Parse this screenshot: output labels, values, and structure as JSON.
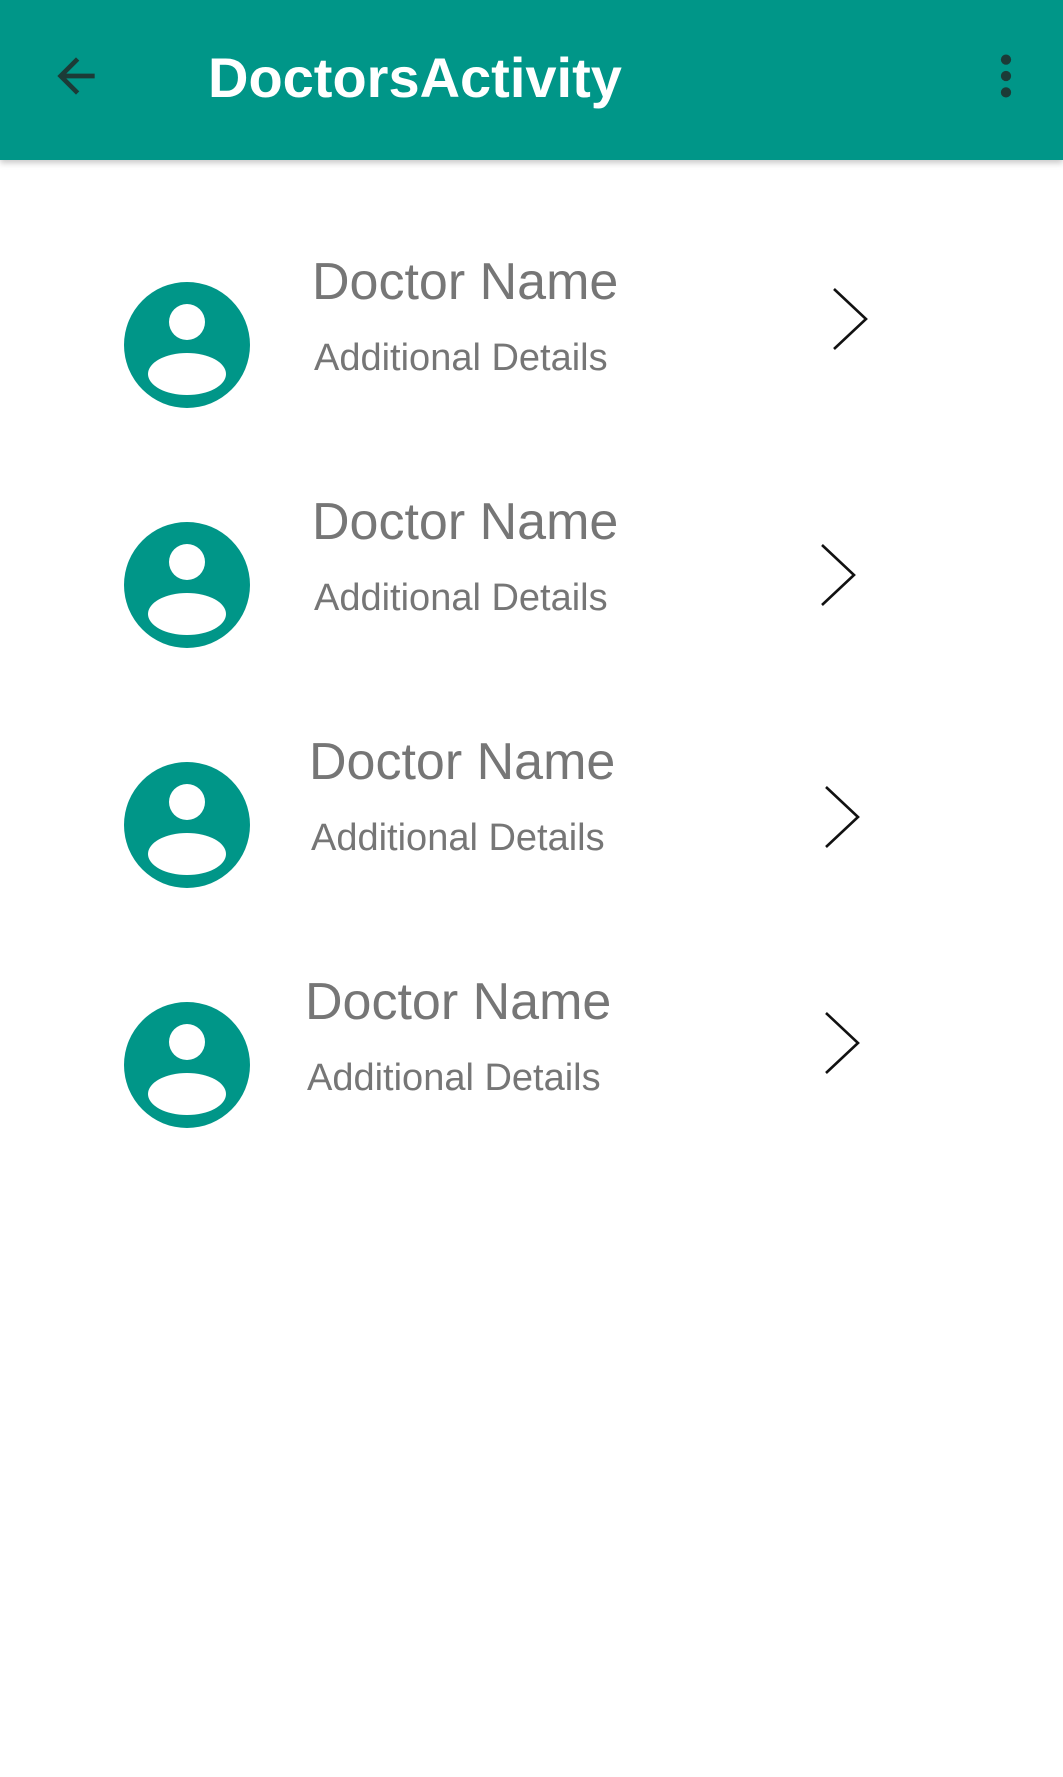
{
  "app_bar": {
    "title": "DoctorsActivity",
    "background_color": "#009688",
    "back_icon": "arrow-left-icon",
    "overflow_icon": "more-vert-icon"
  },
  "doctors": [
    {
      "name": "Doctor Name",
      "details": "Additional Details",
      "avatar_icon": "account-circle-icon",
      "chevron_icon": "chevron-right-icon"
    },
    {
      "name": "Doctor Name",
      "details": "Additional Details",
      "avatar_icon": "account-circle-icon",
      "chevron_icon": "chevron-right-icon"
    },
    {
      "name": "Doctor Name",
      "details": "Additional Details",
      "avatar_icon": "account-circle-icon",
      "chevron_icon": "chevron-right-icon"
    },
    {
      "name": "Doctor Name",
      "details": "Additional Details",
      "avatar_icon": "account-circle-icon",
      "chevron_icon": "chevron-right-icon"
    }
  ],
  "colors": {
    "accent": "#009688",
    "text_secondary": "#767676"
  }
}
